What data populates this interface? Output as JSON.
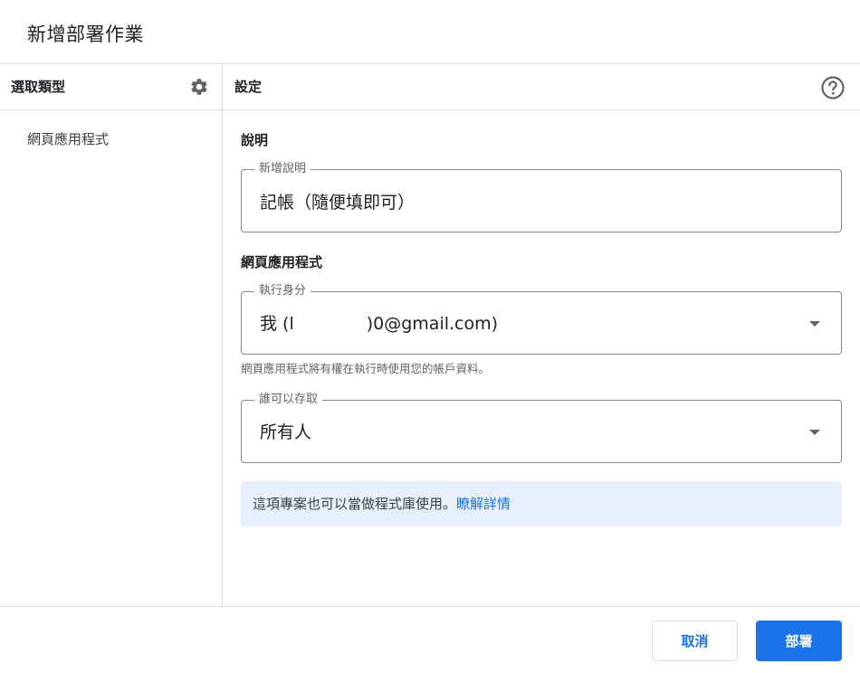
{
  "dialog": {
    "title": "新增部署作業"
  },
  "left_pane": {
    "heading": "選取類型",
    "settings_icon": "gear-icon",
    "items": [
      "網頁應用程式"
    ]
  },
  "right_pane": {
    "heading": "設定",
    "help_icon": "help-circle-icon",
    "description_section": {
      "label": "說明",
      "field_label": "新增說明",
      "field_value": "記帳（隨便填即可）"
    },
    "webapp_section": {
      "label": "網頁應用程式",
      "execute_as": {
        "field_label": "執行身分",
        "value_prefix": "我 (l",
        "value_suffix": ")0@gmail.com)"
      },
      "helper_text": "網頁應用程式將有權在執行時使用您的帳戶資料。",
      "access": {
        "field_label": "誰可以存取",
        "value": "所有人"
      }
    },
    "info_banner": {
      "text": "這項專案也可以當做程式庫使用。",
      "link_text": "瞭解詳情"
    }
  },
  "footer": {
    "cancel_label": "取消",
    "deploy_label": "部署"
  },
  "colors": {
    "accent": "#1a73e8",
    "banner_bg": "#e8f0fe",
    "divider": "#dadce0",
    "outline": "#80868b"
  }
}
